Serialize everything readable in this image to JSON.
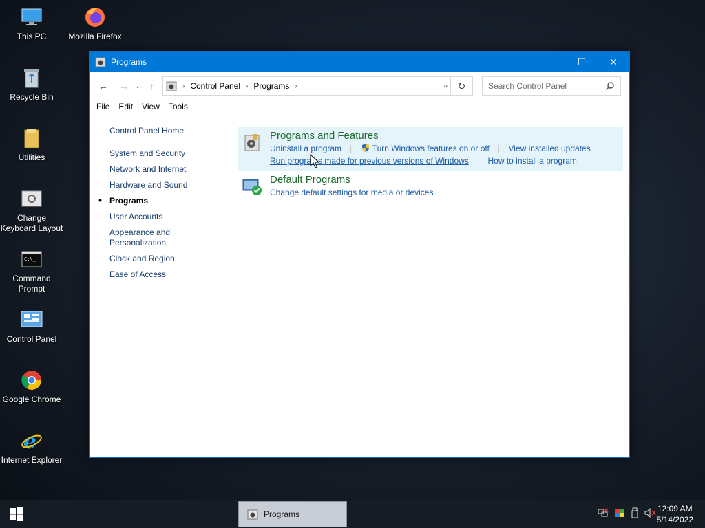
{
  "desktop": {
    "icons": [
      {
        "label": "This PC"
      },
      {
        "label": "Mozilla Firefox"
      },
      {
        "label": "Recycle Bin"
      },
      {
        "label": "Utilities"
      },
      {
        "label": "Change Keyboard Layout"
      },
      {
        "label": "Command Prompt"
      },
      {
        "label": "Control Panel"
      },
      {
        "label": "Google Chrome"
      },
      {
        "label": "Internet Explorer"
      }
    ]
  },
  "window": {
    "title": "Programs",
    "breadcrumb": [
      "Control Panel",
      "Programs"
    ],
    "search_placeholder": "Search Control Panel",
    "menu": [
      "File",
      "Edit",
      "View",
      "Tools"
    ]
  },
  "sidebar": {
    "items": [
      {
        "label": "Control Panel Home"
      },
      {
        "label": "System and Security"
      },
      {
        "label": "Network and Internet"
      },
      {
        "label": "Hardware and Sound"
      },
      {
        "label": "Programs"
      },
      {
        "label": "User Accounts"
      },
      {
        "label": "Appearance and Personalization"
      },
      {
        "label": "Clock and Region"
      },
      {
        "label": "Ease of Access"
      }
    ]
  },
  "main": {
    "categories": [
      {
        "title": "Programs and Features",
        "links": [
          "Uninstall a program",
          "Turn Windows features on or off",
          "View installed updates",
          "Run programs made for previous versions of Windows",
          "How to install a program"
        ]
      },
      {
        "title": "Default Programs",
        "links": [
          "Change default settings for media or devices"
        ]
      }
    ]
  },
  "taskbar": {
    "task_label": "Programs",
    "time": "12:09 AM",
    "date": "5/14/2022"
  },
  "colors": {
    "accent": "#0078d7",
    "link": "#1f5da8",
    "category_title": "#1e6b2e"
  }
}
